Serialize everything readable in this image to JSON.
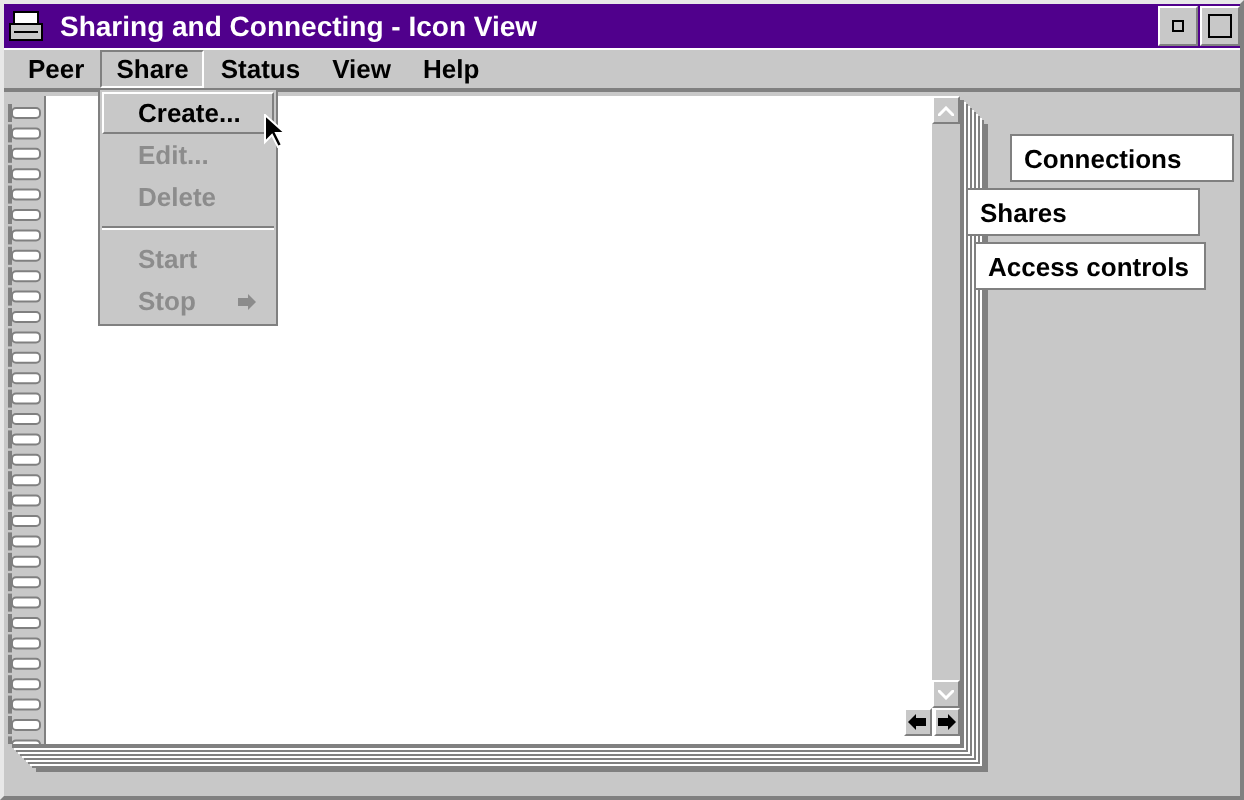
{
  "window": {
    "title": "Sharing and Connecting - Icon View"
  },
  "menu_bar": [
    {
      "label": "Peer",
      "selected": false
    },
    {
      "label": "Share",
      "selected": true
    },
    {
      "label": "Status",
      "selected": false
    },
    {
      "label": "View",
      "selected": false
    },
    {
      "label": "Help",
      "selected": false
    }
  ],
  "dropdown": [
    {
      "kind": "item",
      "label": "Create...",
      "selected": true,
      "disabled": false
    },
    {
      "kind": "item",
      "label": "Edit...",
      "selected": false,
      "disabled": true
    },
    {
      "kind": "item",
      "label": "Delete",
      "selected": false,
      "disabled": true
    },
    {
      "kind": "separator"
    },
    {
      "kind": "item",
      "label": "Start",
      "selected": false,
      "disabled": true
    },
    {
      "kind": "submenu",
      "label": "Stop",
      "selected": false,
      "disabled": true
    }
  ],
  "notebook_tabs": [
    {
      "label": "Connections",
      "selected": false
    },
    {
      "label": "Shares",
      "selected": true
    },
    {
      "label": "Access controls",
      "selected": false
    }
  ]
}
